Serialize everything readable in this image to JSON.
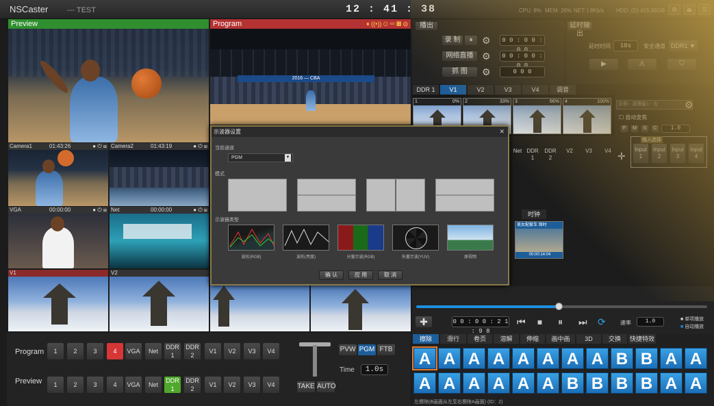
{
  "app": {
    "brand": "NSCaster",
    "project": "--- TEST",
    "clock": "12 : 41 : 38",
    "cpu": "CPU:  8%",
    "mem": "MEM:  26%",
    "net": "NET:  | 8Kb/s",
    "hdd": "HDD: (D) 415.36GB"
  },
  "preview": {
    "label": "Preview"
  },
  "program": {
    "label": "Program",
    "icons": "⏸ ((•)) ⊙ ▭ ▦ ⚙"
  },
  "sources": [
    {
      "name": "Camera1",
      "time": "01:43:26"
    },
    {
      "name": "Camera2",
      "time": "01:43:19"
    },
    {
      "name": "VGA",
      "time": "00:00:00"
    },
    {
      "name": "Net",
      "time": "00:00:00"
    },
    {
      "name": "V1",
      "time": ""
    },
    {
      "name": "V2",
      "time": ""
    }
  ],
  "bus": {
    "program_label": "Program",
    "preview_label": "Preview",
    "buttons": [
      "1",
      "2",
      "3",
      "4",
      "VGA",
      "Net",
      "DDR\n1",
      "DDR\n2",
      "V1",
      "V2",
      "V3",
      "V4"
    ],
    "program_active": "4",
    "preview_active": "DDR\n1"
  },
  "transition": {
    "pvw": "PVW",
    "pgm": "PGM",
    "ftb": "FTB",
    "time_label": "Time",
    "time": "1.0s",
    "take": "TAKE",
    "auto": "AUTO"
  },
  "output": {
    "section": "播出",
    "record": "录 制",
    "stream": "网络直播",
    "snapshot": "抓 图",
    "rec_time": "0 0 : 0 0 : 0 0",
    "stream_time": "0 0 : 0 0 : 0 0",
    "snap_count": "0 0 0"
  },
  "delay": {
    "section": "延时输出",
    "time_label": "延时时间",
    "time": "10s",
    "safe_label": "安全通道",
    "ddr": "DDR1"
  },
  "media_tabs": [
    "DDR 1",
    "V1",
    "V2",
    "V3",
    "V4",
    "调音"
  ],
  "media_active": "V1",
  "clips": [
    {
      "n": "1",
      "p": "0%"
    },
    {
      "n": "2",
      "p": "33%"
    },
    {
      "n": "3",
      "p": "66%"
    },
    {
      "n": "4",
      "p": "100%"
    }
  ],
  "right_panel": {
    "preset": "示例 - 清理窗1 - 左",
    "auto_transition": "自动变焦",
    "letters": [
      "F",
      "M",
      "S",
      "C"
    ],
    "speed": "1.0",
    "input_section": "输入选择",
    "inputs": [
      "Input\n1",
      "Input\n2",
      "Input\n3",
      "Input\n4"
    ],
    "src_buttons": [
      "Net",
      "DDR\n1",
      "DDR\n2",
      "V2",
      "V3",
      "V4"
    ]
  },
  "clock_tab": "时钟",
  "clip_thumb": {
    "title": "美女配套车 保时",
    "time": "00:00:14:04"
  },
  "player": {
    "time": "0 0 : 0 0 : 2 1 : 9 8",
    "rate_label": "速率",
    "rate": "1.0",
    "single": "单项播放",
    "autoplay": "自动播放"
  },
  "trans_tabs": [
    "擦除",
    "滑行",
    "卷页",
    "溶解",
    "伸缩",
    "画中画",
    "3D",
    "交换",
    "快捷特效"
  ],
  "trans_active": "擦除",
  "trans_tiles": [
    "A",
    "A",
    "A",
    "A",
    "A",
    "A",
    "A",
    "A",
    "B",
    "B",
    "A",
    "A",
    "A",
    "A",
    "A",
    "A",
    "A",
    "A",
    "B",
    "B",
    "B",
    "B",
    "A",
    "A"
  ],
  "status_text": "左擦除(B画面从左至右擦除A画面) (ID：2)",
  "dialog": {
    "title": "示波器设置",
    "channel_label": "当前通道",
    "channel": "PGM",
    "mode_label": "模式",
    "type_label": "示波器类型",
    "scopes": [
      "波形(RGB)",
      "波形(亮度)",
      "分量示波(RGB)",
      "矢量示波(YUV)",
      "原视频"
    ],
    "ok": "确 认",
    "apply": "应 用",
    "cancel": "取 消",
    "close": "✕"
  },
  "colors": {
    "preview": "#2f8f2f",
    "program": "#b43232",
    "accent": "#1d5d99",
    "highlight": "#d63636",
    "green": "#4ea82a"
  }
}
